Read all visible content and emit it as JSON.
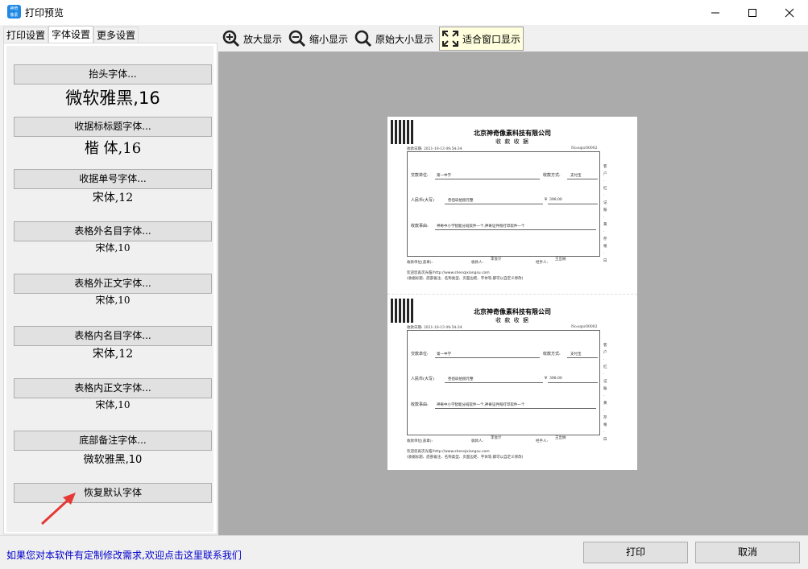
{
  "window": {
    "title": "打印预览",
    "app_icon_text": "神奇\n像素"
  },
  "tabs": [
    {
      "label": "打印设置"
    },
    {
      "label": "字体设置"
    },
    {
      "label": "更多设置"
    }
  ],
  "fonts": [
    {
      "button": "抬头字体...",
      "value": "微软雅黑,16"
    },
    {
      "button": "收据标标题字体...",
      "value": "楷 体,16"
    },
    {
      "button": "收据单号字体...",
      "value": "宋体,12"
    },
    {
      "button": "表格外名目字体...",
      "value": "宋体,10"
    },
    {
      "button": "表格外正文字体...",
      "value": "宋体,10"
    },
    {
      "button": "表格内名目字体...",
      "value": "宋体,12"
    },
    {
      "button": "表格内正文字体...",
      "value": "宋体,10"
    },
    {
      "button": "底部备注字体...",
      "value": "微软雅黑,10"
    }
  ],
  "restore_button": "恢复默认字体",
  "toolbar": {
    "zoom_in": "放大显示",
    "zoom_out": "缩小显示",
    "original_size": "原始大小显示",
    "fit_window": "适合窗口显示"
  },
  "receipt": {
    "company": "北京神奇像素科技有限公司",
    "title": "收 款 收 据",
    "date": "收款日期:    2021-10-13 09:54:34",
    "number": "No:sqsc00002",
    "payer_label": "交款单位:",
    "payer_value": "第一中学",
    "method_label": "收款方式:",
    "method_value": "支付宝",
    "amount_label": "人民币(大写)",
    "amount_value": "叁佰玖拾捌元整",
    "amount_symbol": "¥",
    "amount_num": "398.00",
    "reason_label": "收款事由:",
    "reason_value": "神奇中小学智能分班软件一个,神奇证件照打印软件一个",
    "side_text": "客户 · 红 · 记账 · 黄 · 存根 · 白",
    "accountant": "李会计",
    "cashier": "王出纳",
    "unit_sign": "收款单位(盖章):",
    "payee": "收款人:",
    "handler": "经手人:",
    "note1": "欢迎您再次光临!http://www.shenqixiangsu.com",
    "note2": "(收据标题、底部备注、名称类型、页面边距、字体等,都可以自定义修改)"
  },
  "footer": {
    "contact": "如果您对本软件有定制修改需求,欢迎点击这里联系我们",
    "print": "打印",
    "cancel": "取消"
  },
  "colors": {
    "accent": "#1e88e5",
    "link": "#0000cc",
    "arrow": "#e53935",
    "preview_bg": "#ababab"
  }
}
